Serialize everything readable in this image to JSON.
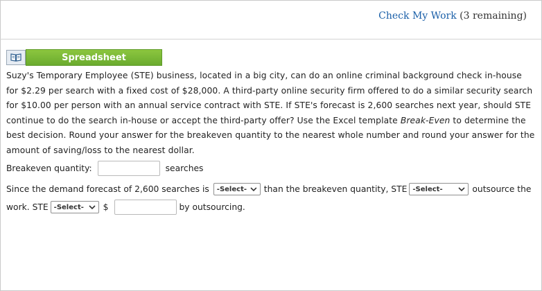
{
  "header": {
    "check_link": "Check My Work",
    "remaining": "(3 remaining)"
  },
  "spreadsheet": {
    "label": "Spreadsheet",
    "icon": "book-icon"
  },
  "problem": {
    "text_before_italic": "Suzy's Temporary Employee (STE) business, located in a big city, can do an online criminal background check in-house for $2.29 per search with a fixed cost of $28,000. A third-party online security firm offered to do a similar security search for $10.00 per person with an annual service contract with STE. If STE's forecast is 2,600 searches next year, should STE continue to do the search in-house or accept the third-party offer? Use the Excel template ",
    "italic_text": "Break-Even",
    "text_after_italic": " to determine the best decision. Round your answer for the breakeven quantity to the nearest whole number and round your answer for the amount of saving/loss to the nearest dollar."
  },
  "breakeven": {
    "label": "Breakeven quantity:",
    "value": "",
    "unit": "searches"
  },
  "conclusion": {
    "part1": "Since the demand forecast of 2,600 searches is",
    "select1": "-Select-",
    "part2": "than the breakeven quantity, STE",
    "select2": "-Select-",
    "part3": "outsource the",
    "part4": "work. STE",
    "select3": "-Select-",
    "dollar": "$",
    "amount_value": "",
    "part5": "by outsourcing."
  },
  "colors": {
    "link": "#1a5fa8",
    "spreadsheet_green": "#7ab83a"
  }
}
